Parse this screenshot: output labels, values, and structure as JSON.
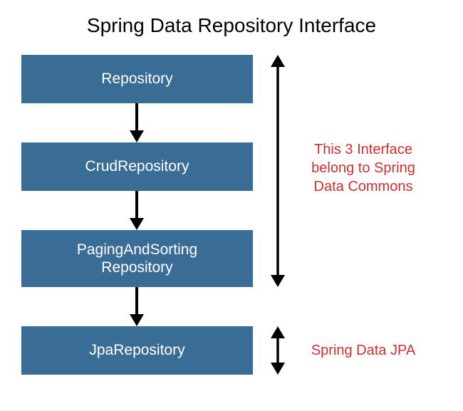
{
  "title": "Spring Data Repository Interface",
  "boxes": [
    {
      "label": "Repository"
    },
    {
      "label": "CrudRepository"
    },
    {
      "label": "PagingAndSorting Repository"
    },
    {
      "label": "JpaRepository"
    }
  ],
  "annotations": [
    {
      "text": "This 3 Interface belong to Spring Data Commons"
    },
    {
      "text": "Spring Data JPA"
    }
  ],
  "colors": {
    "box_bg": "#3a6d95",
    "box_text": "#ffffff",
    "annotation_text": "#d12f2f",
    "arrow": "#000000"
  }
}
